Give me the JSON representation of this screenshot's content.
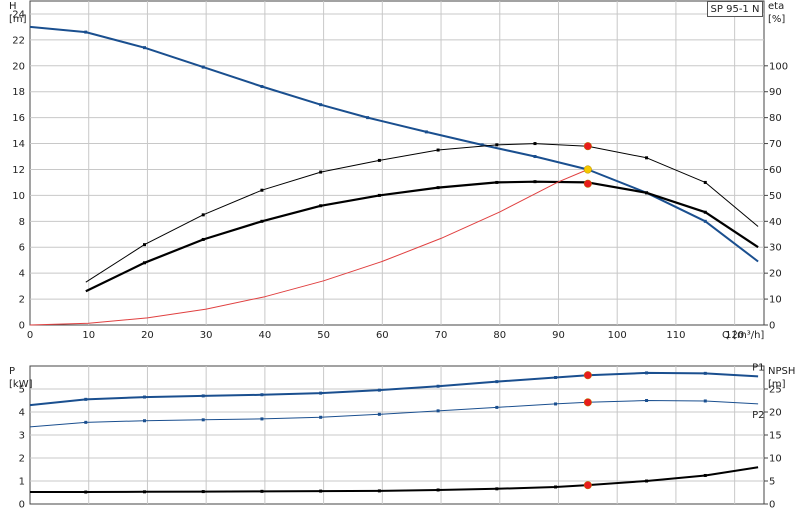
{
  "chart_data": [
    {
      "type": "line",
      "title": "SP 95-1 N",
      "xlabel": "Q [m³/h]",
      "ylabel_left_unit": "H",
      "ylabel_left_bracket": "[m]",
      "ylabel_right_unit": "eta",
      "ylabel_right_bracket": "[%]",
      "xlim": [
        0,
        125
      ],
      "ylim_left": [
        0,
        25
      ],
      "ylim_right": [
        0,
        125
      ],
      "x_ticks": [
        0,
        10,
        20,
        30,
        40,
        50,
        60,
        70,
        80,
        90,
        100,
        110,
        120
      ],
      "y_left_ticks": [
        0,
        2,
        4,
        6,
        8,
        10,
        12,
        14,
        16,
        18,
        20,
        22,
        24
      ],
      "y_right_ticks": [
        0,
        10,
        20,
        30,
        40,
        50,
        60,
        70,
        80,
        90,
        100
      ],
      "grid": true,
      "series": [
        {
          "axis": "left",
          "color": "#1a4f8f",
          "x": [
            0,
            9.5,
            19.5,
            29.5,
            39.5,
            49.5,
            57.5,
            67.5,
            77,
            86,
            95,
            105,
            115,
            124
          ],
          "values": [
            23.0,
            22.6,
            21.4,
            19.9,
            18.4,
            17.0,
            16.0,
            14.9,
            13.9,
            13.0,
            12.0,
            10.2,
            8.0,
            4.9
          ]
        },
        {
          "axis": "right",
          "color": "#000000",
          "x": [
            9.5,
            19.5,
            29.5,
            39.5,
            49.5,
            59.5,
            69.5,
            79.5,
            86,
            95,
            105,
            115,
            124
          ],
          "values": [
            13.0,
            24.0,
            33.0,
            40.0,
            46.0,
            50.0,
            53.0,
            55.0,
            55.3,
            55.0,
            51.0,
            43.5,
            30.0
          ]
        },
        {
          "axis": "right",
          "color": "#000000",
          "x": [
            9.5,
            19.5,
            29.5,
            39.5,
            49.5,
            59.5,
            69.5,
            79.5,
            86,
            95,
            105,
            115,
            124
          ],
          "values": [
            16.5,
            31.0,
            42.5,
            52.0,
            59.0,
            63.5,
            67.5,
            69.5,
            70.0,
            69.0,
            64.5,
            55.0,
            38.0
          ]
        },
        {
          "axis": "left",
          "color": "#e04040",
          "x": [
            0,
            10,
            20,
            30,
            40,
            50,
            60,
            70,
            80,
            90,
            95
          ],
          "values": [
            0.0,
            0.14,
            0.55,
            1.23,
            2.18,
            3.41,
            4.91,
            6.68,
            8.73,
            11.05,
            12.0
          ]
        }
      ],
      "markers": [
        {
          "x": 95,
          "y": 13.8,
          "axis": "left",
          "color": "#e81c1c"
        },
        {
          "x": 95,
          "y": 12.0,
          "axis": "left",
          "color": "#f5c800"
        },
        {
          "x": 95,
          "y": 10.9,
          "axis": "left",
          "color": "#e81c1c"
        }
      ]
    },
    {
      "type": "line",
      "ylabel_left_unit": "P",
      "ylabel_left_bracket": "[kW]",
      "ylabel_right_unit": "NPSH",
      "ylabel_right_bracket": "[m]",
      "xlim": [
        0,
        125
      ],
      "ylim_left": [
        0,
        6
      ],
      "ylim_right": [
        0,
        30
      ],
      "y_left_ticks": [
        0,
        1,
        2,
        3,
        4,
        5
      ],
      "y_right_ticks": [
        0,
        5,
        10,
        15,
        20,
        25
      ],
      "grid": true,
      "series": [
        {
          "name": "P1",
          "axis": "left",
          "color": "#1a4f8f",
          "x": [
            0,
            9.5,
            19.5,
            29.5,
            39.5,
            49.5,
            59.5,
            69.5,
            79.5,
            89.5,
            95,
            105,
            115,
            124
          ],
          "values": [
            4.3,
            4.55,
            4.65,
            4.7,
            4.75,
            4.82,
            4.95,
            5.12,
            5.32,
            5.5,
            5.6,
            5.7,
            5.68,
            5.55
          ]
        },
        {
          "name": "P2",
          "axis": "left",
          "color": "#1a4f8f",
          "x": [
            0,
            9.5,
            19.5,
            29.5,
            39.5,
            49.5,
            59.5,
            69.5,
            79.5,
            89.5,
            95,
            105,
            115,
            124
          ],
          "values": [
            3.35,
            3.55,
            3.62,
            3.66,
            3.7,
            3.77,
            3.9,
            4.05,
            4.2,
            4.35,
            4.42,
            4.5,
            4.48,
            4.35
          ]
        },
        {
          "axis": "right",
          "color": "#000000",
          "x": [
            0,
            9.5,
            19.5,
            29.5,
            39.5,
            49.5,
            59.5,
            69.5,
            79.5,
            89.5,
            95,
            105,
            115,
            124
          ],
          "values": [
            2.6,
            2.6,
            2.65,
            2.7,
            2.75,
            2.8,
            2.85,
            3.05,
            3.3,
            3.7,
            4.1,
            5.0,
            6.2,
            8.0
          ]
        }
      ],
      "markers": [
        {
          "x": 95,
          "y": 5.6,
          "axis": "left",
          "color": "#e81c1c"
        },
        {
          "x": 95,
          "y": 4.42,
          "axis": "left",
          "color": "#e81c1c"
        },
        {
          "x": 95,
          "y": 4.1,
          "axis": "right",
          "color": "#e81c1c"
        }
      ]
    }
  ]
}
